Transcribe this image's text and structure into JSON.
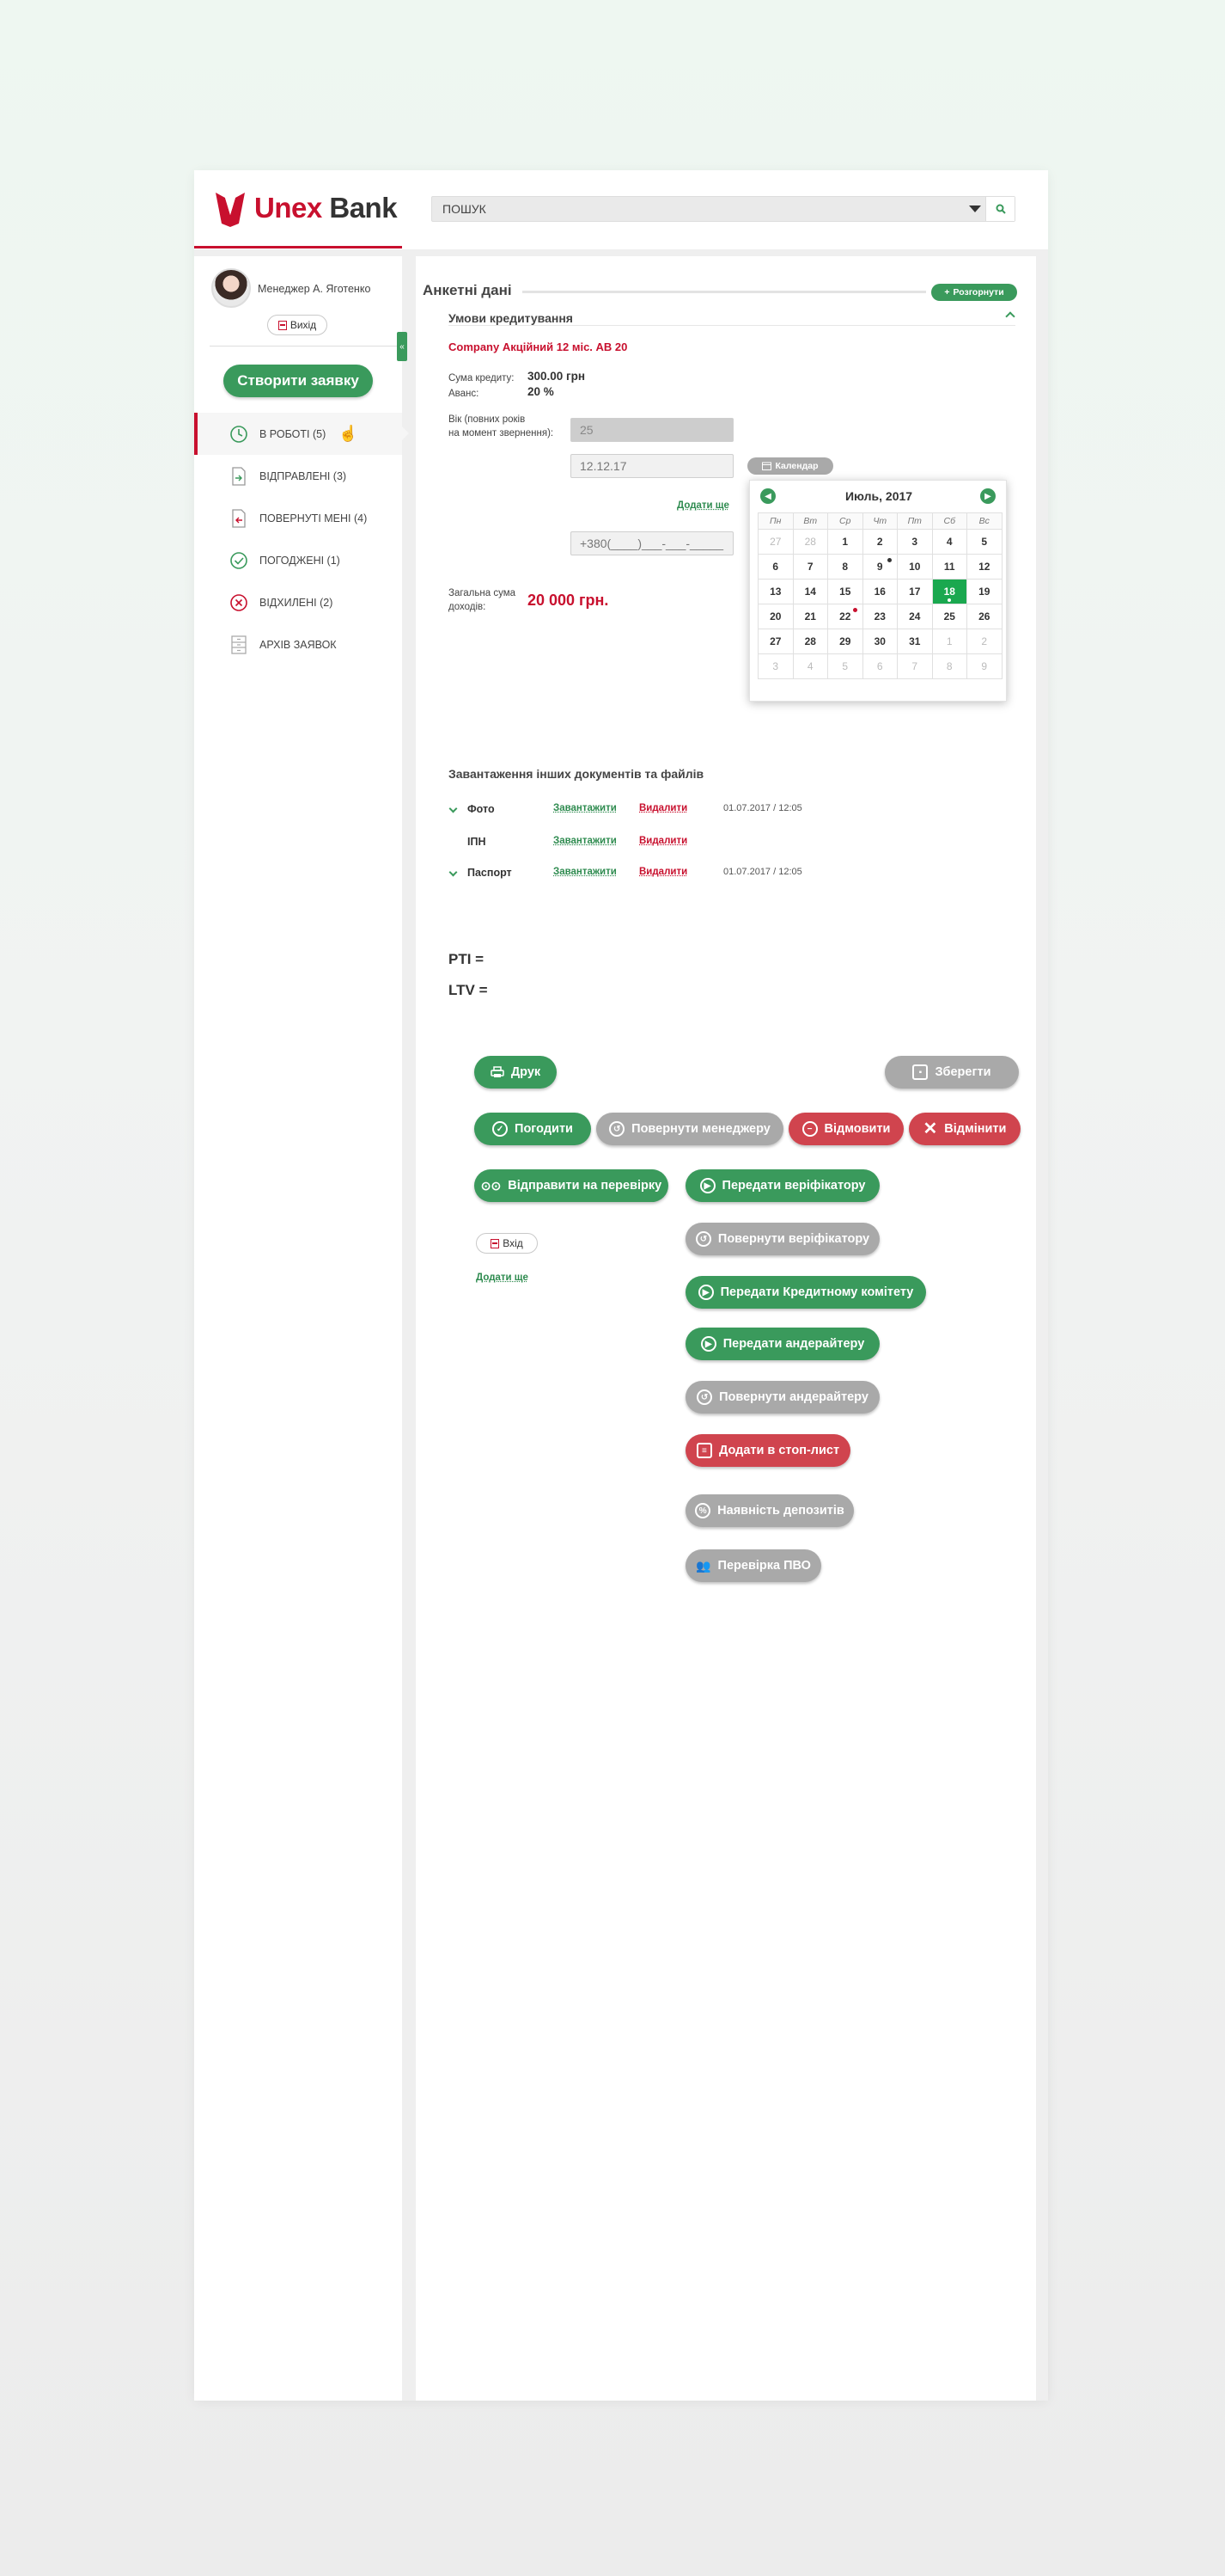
{
  "header": {
    "logo_unex": "Unex",
    "logo_bank": "Bank",
    "search_placeholder": "ПОШУК"
  },
  "sidebar": {
    "manager_name": "Менеджер А. Яготенко",
    "logout_label": "Вихід",
    "create_label": "Створити заявку",
    "items": [
      {
        "label": "В РОБОТІ (5)",
        "icon": "clock-icon",
        "active": true
      },
      {
        "label": "ВІДПРАВЛЕНІ (3)",
        "icon": "doc-sent-icon",
        "active": false
      },
      {
        "label": "ПОВЕРНУТІ МЕНІ (4)",
        "icon": "doc-returned-icon",
        "active": false
      },
      {
        "label": "ПОГОДЖЕНІ (1)",
        "icon": "check-circle-icon",
        "active": false
      },
      {
        "label": "ВІДХИЛЕНІ (2)",
        "icon": "x-circle-icon",
        "active": false
      },
      {
        "label": "АРХІВ ЗАЯВОК",
        "icon": "archive-icon",
        "active": false
      }
    ]
  },
  "form": {
    "section_title": "Анкетні дані",
    "expand_label": "Розгорнути",
    "sub_title": "Умови кредитування",
    "product": "Company Акційний 12 міс. АВ 20",
    "credit_sum_label": "Сума кредиту:",
    "credit_sum_value": "300.00 грн",
    "advance_label": "Аванс:",
    "advance_value": "20 %",
    "age_label_1": "Вік (повних років",
    "age_label_2": "на момент звернення):",
    "age_value": "25",
    "date_value": "12.12.17",
    "calendar_chip": "Календар",
    "add_more": "Додати ще",
    "phone_placeholder": "+380(____)___-___-_____",
    "income_label_1": "Загальна сума",
    "income_label_2": "доходів:",
    "income_value": "20 000 грн."
  },
  "calendar": {
    "month": "Июль, 2017",
    "weekdays": [
      "Пн",
      "Вт",
      "Ср",
      "Чт",
      "Пт",
      "Сб",
      "Вс"
    ],
    "days": [
      {
        "d": "27",
        "m": true
      },
      {
        "d": "28",
        "m": true
      },
      {
        "d": "1"
      },
      {
        "d": "2"
      },
      {
        "d": "3"
      },
      {
        "d": "4"
      },
      {
        "d": "5"
      },
      {
        "d": "6"
      },
      {
        "d": "7"
      },
      {
        "d": "8"
      },
      {
        "d": "9",
        "dot": "#333"
      },
      {
        "d": "10"
      },
      {
        "d": "11"
      },
      {
        "d": "12"
      },
      {
        "d": "13"
      },
      {
        "d": "14"
      },
      {
        "d": "15"
      },
      {
        "d": "16"
      },
      {
        "d": "17"
      },
      {
        "d": "18",
        "sel": true
      },
      {
        "d": "19"
      },
      {
        "d": "20"
      },
      {
        "d": "21"
      },
      {
        "d": "22",
        "dot": "#c8102e"
      },
      {
        "d": "23"
      },
      {
        "d": "24"
      },
      {
        "d": "25"
      },
      {
        "d": "26"
      },
      {
        "d": "27"
      },
      {
        "d": "28"
      },
      {
        "d": "29"
      },
      {
        "d": "30"
      },
      {
        "d": "31"
      },
      {
        "d": "1",
        "m": true
      },
      {
        "d": "2",
        "m": true
      },
      {
        "d": "3",
        "m": true
      },
      {
        "d": "4",
        "m": true
      },
      {
        "d": "5",
        "m": true
      },
      {
        "d": "6",
        "m": true
      },
      {
        "d": "7",
        "m": true
      },
      {
        "d": "8",
        "m": true
      },
      {
        "d": "9",
        "m": true
      }
    ]
  },
  "documents": {
    "title": "Завантаження інших документів та файлів",
    "upload_label": "Завантажити",
    "delete_label": "Видалити",
    "rows": [
      {
        "name": "Фото",
        "date": "01.07.2017 / 12:05",
        "chevron": true
      },
      {
        "name": "ІПН",
        "date": "",
        "chevron": false
      },
      {
        "name": "Паспорт",
        "date": "01.07.2017 / 12:05",
        "chevron": true
      }
    ]
  },
  "ratios": {
    "pti": "PTI =",
    "ltv": "LTV ="
  },
  "actions": {
    "print": "Друк",
    "save": "Зберегти",
    "approve": "Погодити",
    "return_manager": "Повернути менеджеру",
    "decline": "Відмовити",
    "cancel": "Відмінити",
    "send_check": "Відправити на перевірку",
    "to_verifier": "Передати веріфікатору",
    "return_verifier": "Повернути веріфікатору",
    "to_committee": "Передати Кредитному комітету",
    "to_underwriter": "Передати андерайтеру",
    "return_underwriter": "Повернути андерайтеру",
    "stop_list": "Додати в стоп-лист",
    "deposits": "Наявність депозитів",
    "pvo_check": "Перевірка ПВО",
    "login": "Вхід",
    "add_more": "Додати ще"
  },
  "colors": {
    "brand_red": "#c8102e",
    "brand_green": "#3a9a5c",
    "button_gray": "#a9a9a9",
    "button_red": "#d0444e"
  }
}
